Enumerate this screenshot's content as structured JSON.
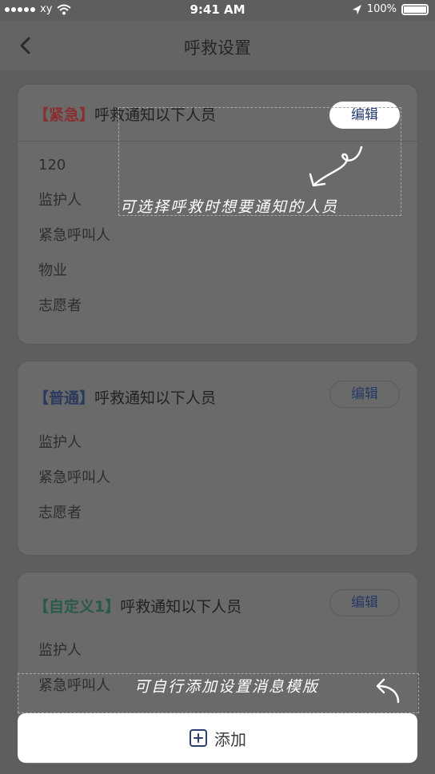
{
  "status_bar": {
    "carrier": "xy",
    "time": "9:41 AM",
    "battery": "100%"
  },
  "nav": {
    "title": "呼救设置"
  },
  "cards": [
    {
      "tag": "【紧急】",
      "title": "呼救通知以下人员",
      "edit_label": "编辑",
      "tag_color": "#8a2f2f",
      "members": [
        "120",
        "监护人",
        "紧急呼叫人",
        "物业",
        "志愿者"
      ]
    },
    {
      "tag": "【普通】",
      "title": "呼救通知以下人员",
      "edit_label": "编辑",
      "tag_color": "#2b3a5e",
      "members": [
        "监护人",
        "紧急呼叫人",
        "志愿者"
      ]
    },
    {
      "tag": "【自定义1】",
      "title": "呼救通知以下人员",
      "edit_label": "编辑",
      "tag_color": "#2b5a4c",
      "members": [
        "监护人",
        "紧急呼叫人"
      ]
    }
  ],
  "annotations": {
    "select_people": "可选择呼救时想要通知的人员",
    "add_template": "可自行添加设置消息模版"
  },
  "footer": {
    "add_label": "添加"
  }
}
